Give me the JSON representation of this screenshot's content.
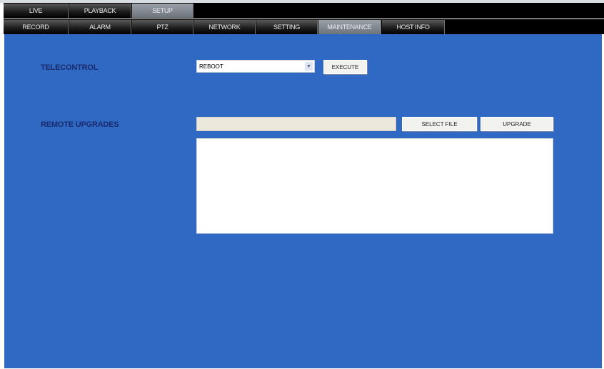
{
  "main_tabs": [
    {
      "label": "LIVE"
    },
    {
      "label": "PLAYBACK"
    },
    {
      "label": "SETUP"
    }
  ],
  "sub_tabs": [
    {
      "label": "RECORD"
    },
    {
      "label": "ALARM"
    },
    {
      "label": "PTZ"
    },
    {
      "label": "NETWORK"
    },
    {
      "label": "SETTING"
    },
    {
      "label": "MAINTENANCE"
    },
    {
      "label": "HOST INFO"
    }
  ],
  "active_main_tab": "SETUP",
  "active_sub_tab": "MAINTENANCE",
  "telecontrol": {
    "label": "TELECONTROL",
    "selected": "REBOOT",
    "execute_label": "EXECUTE",
    "arrow_icon": "chevron-down-icon"
  },
  "remote_upgrades": {
    "label": "REMOTE UPGRADES",
    "file_value": "",
    "select_file_label": "SELECT FILE",
    "upgrade_label": "UPGRADE",
    "log": ""
  },
  "colors": {
    "panel": "#3069c4",
    "label": "#1a2a6a",
    "tabbar": "#000000"
  }
}
